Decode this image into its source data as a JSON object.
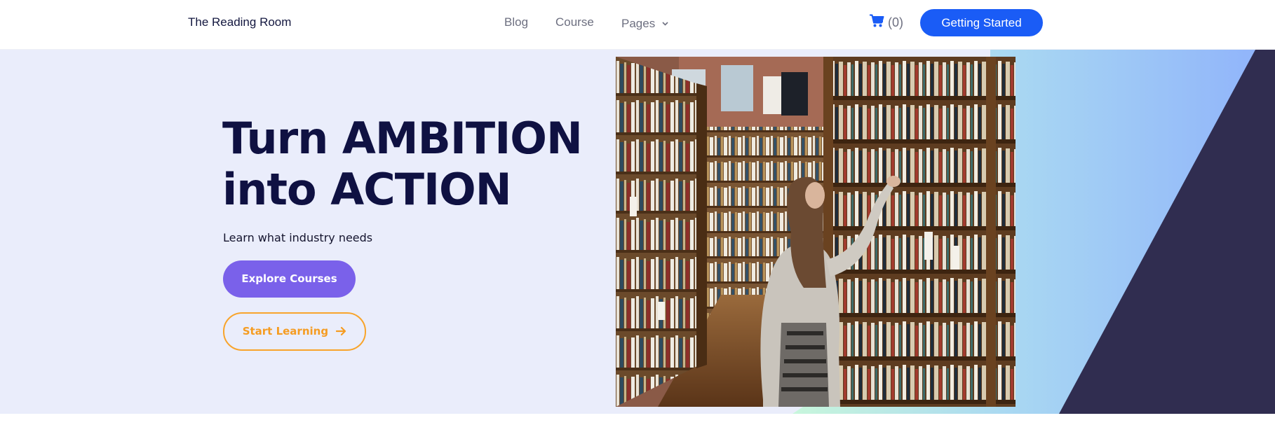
{
  "header": {
    "logo": "The Reading Room",
    "nav": [
      {
        "label": "Blog"
      },
      {
        "label": "Course"
      },
      {
        "label": "Pages"
      }
    ],
    "cart_count": "(0)",
    "cta_label": "Getting Started"
  },
  "hero": {
    "headline_line1": "Turn AMBITION",
    "headline_line2": "into ACTION",
    "subtitle": "Learn what industry needs",
    "primary_button": "Explore Courses",
    "secondary_button": "Start Learning"
  },
  "colors": {
    "brand_blue": "#1a5cf6",
    "heading_navy": "#0f1142",
    "hero_background": "#eaedfb",
    "primary_button": "#7a61ea",
    "secondary_button_outline": "#f8a42b",
    "dark_panel": "#302d50"
  },
  "icons": [
    "cart-icon",
    "chevron-down-icon",
    "arrow-right-icon"
  ]
}
